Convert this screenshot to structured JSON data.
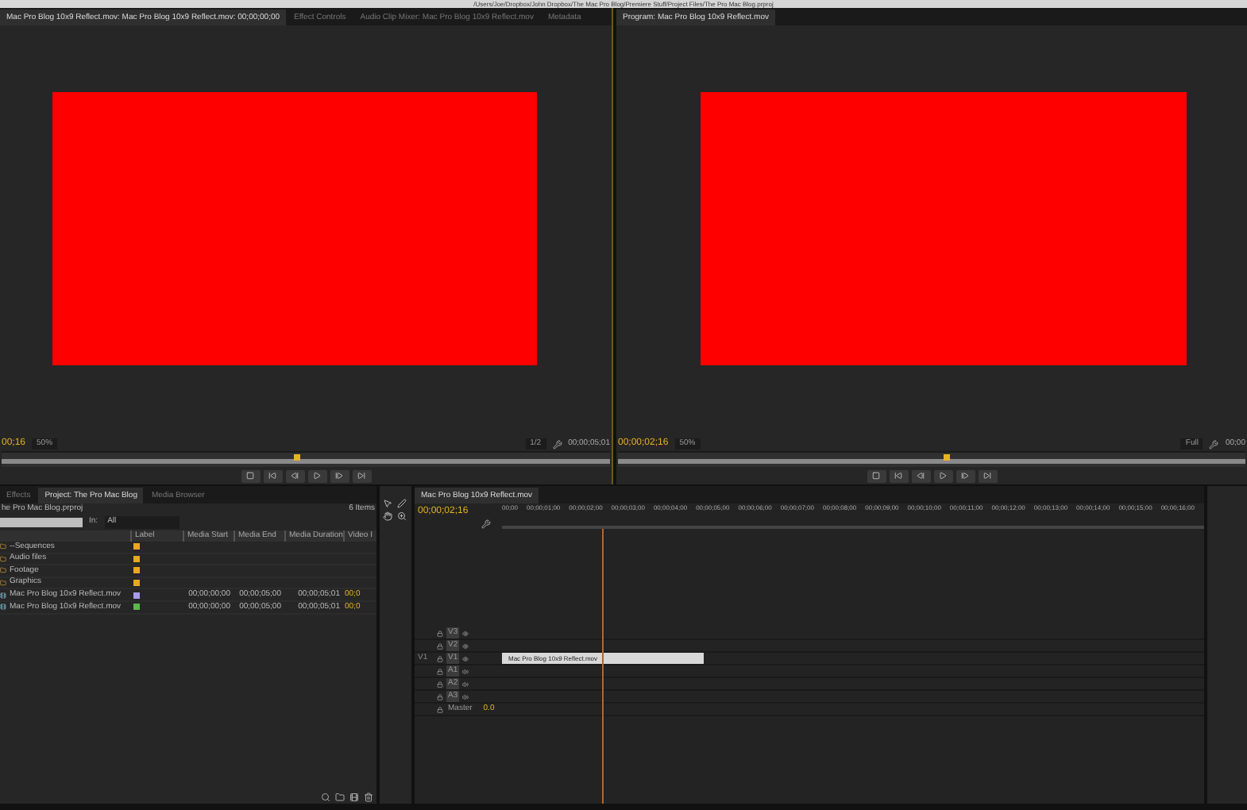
{
  "title_bar": {
    "path": "/Users/Joe/Dropbox/John Dropbox/The Mac Pro Blog/Premiere Stuff/Project Files/The Pro Mac Blog.prproj"
  },
  "source_monitor": {
    "tabs": [
      {
        "label": "Mac Pro Blog 10x9 Reflect.mov: Mac Pro Blog 10x9 Reflect.mov: 00;00;00;00",
        "selected": true
      },
      {
        "label": "Effect Controls",
        "selected": false
      },
      {
        "label": "Audio Clip Mixer: Mac Pro Blog 10x9 Reflect.mov",
        "selected": false
      },
      {
        "label": "Metadata",
        "selected": false
      }
    ],
    "timecode": "00;16",
    "zoom": "50%",
    "quality": "1/2",
    "duration": "00;00;05;01",
    "playhead": {
      "level": 0.48
    }
  },
  "program_monitor": {
    "tabs": [
      {
        "label": "Program: Mac Pro Blog 10x9 Reflect.mov",
        "selected": true
      }
    ],
    "timecode": "00;00;02;16",
    "zoom": "50%",
    "quality": "Full",
    "duration": "00;00",
    "playhead": {
      "level": 0.52
    }
  },
  "project": {
    "tabs": [
      {
        "label": "Effects",
        "selected": false
      },
      {
        "label": "Project: The Pro Mac Blog",
        "selected": true
      },
      {
        "label": "Media Browser",
        "selected": false
      }
    ],
    "file": "he Pro Mac Blog.prproj",
    "item_count": "6 Items",
    "in_label": "In:",
    "filter": "All",
    "columns": [
      "Label",
      "Media Start",
      "Media End",
      "Media Duration",
      "Video I"
    ],
    "rows": [
      {
        "kind": "bin",
        "name": "--Sequences",
        "color": "#e8a824"
      },
      {
        "kind": "bin",
        "name": "Audio files",
        "color": "#e8a824"
      },
      {
        "kind": "bin",
        "name": "Footage",
        "color": "#e8a824"
      },
      {
        "kind": "bin",
        "name": "Graphics",
        "color": "#e8a824"
      },
      {
        "kind": "clip",
        "name": "Mac Pro Blog 10x9 Reflect.mov",
        "color": "#a89ce8",
        "media_start": "00;00;00;00",
        "media_end": "00;00;05;00",
        "media_duration": "00;00;05;01",
        "video_info": "00;0"
      },
      {
        "kind": "clip",
        "name": "Mac Pro Blog 10x9 Reflect.mov",
        "color": "#5cb84a",
        "media_start": "00;00;00;00",
        "media_end": "00;00;05;00",
        "media_duration": "00;00;05;01",
        "video_info": "00;0"
      }
    ]
  },
  "timeline": {
    "tabs": [
      {
        "label": "Mac Pro Blog 10x9 Reflect.mov",
        "selected": true
      }
    ],
    "timecode": "00;00;02;16",
    "ruler": [
      "00;00",
      "00;00;01;00",
      "00;00;02;00",
      "00;00;03;00",
      "00;00;04;00",
      "00;00;05;00",
      "00;00;06;00",
      "00;00;07;00",
      "00;00;08;00",
      "00;00;09;00",
      "00;00;10;00",
      "00;00;11;00",
      "00;00;12;00",
      "00;00;13;00",
      "00;00;14;00",
      "00;00;15;00",
      "00;00;16;00"
    ],
    "tracks": [
      {
        "kind": "video",
        "name": "V3"
      },
      {
        "kind": "video",
        "name": "V2"
      },
      {
        "kind": "video",
        "name": "V1",
        "source": "V1",
        "clip": "Mac Pro Blog 10x9 Reflect.mov"
      },
      {
        "kind": "audio",
        "name": "A1"
      },
      {
        "kind": "audio",
        "name": "A2"
      },
      {
        "kind": "audio",
        "name": "A3"
      },
      {
        "kind": "master",
        "name": "Master",
        "value": "0.0"
      }
    ]
  }
}
